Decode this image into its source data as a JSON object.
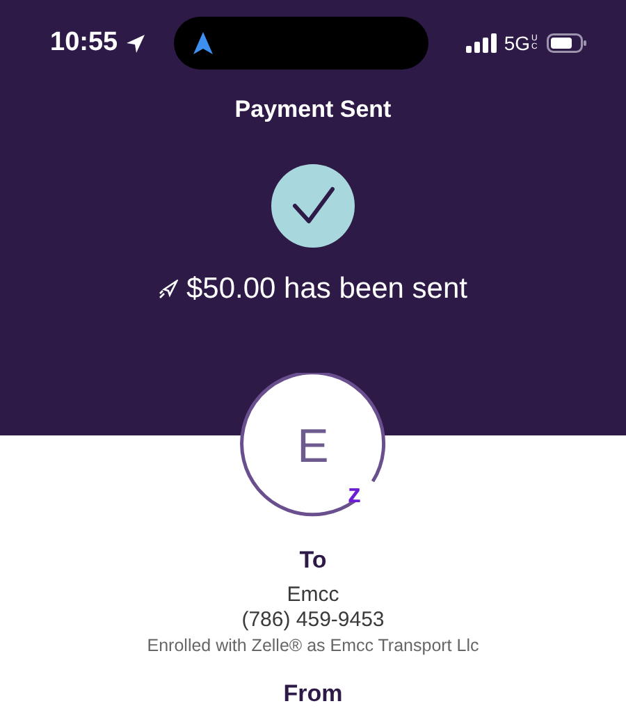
{
  "status_bar": {
    "time": "10:55",
    "network": "5G",
    "network_sub": "UC"
  },
  "header": {
    "title": "Payment Sent"
  },
  "confirmation": {
    "amount_text": "$50.00 has been sent"
  },
  "recipient": {
    "initial": "E",
    "zelle_mark": "z"
  },
  "to": {
    "heading": "To",
    "name": "Emcc",
    "phone": "(786) 459-9453",
    "enrolled": "Enrolled with Zelle® as Emcc Transport Llc"
  },
  "from": {
    "heading": "From"
  }
}
